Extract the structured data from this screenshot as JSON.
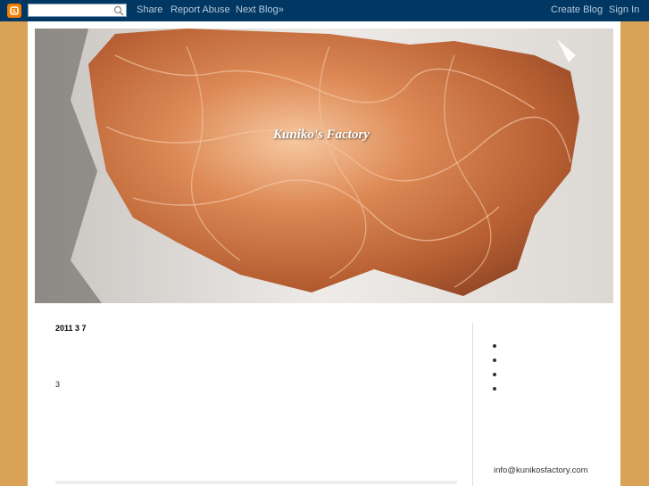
{
  "navbar": {
    "search": {
      "value": "",
      "placeholder": ""
    },
    "links": {
      "share": "Share",
      "report_abuse": "Report Abuse",
      "next_blog": "Next Blog»"
    },
    "right_links": {
      "create_blog": "Create Blog",
      "sign_in": "Sign In"
    }
  },
  "header": {
    "title": "Kuniko's Factory"
  },
  "post": {
    "date": "2011  3  7",
    "body": "3"
  },
  "sidebar": {
    "items": [
      "",
      "",
      "",
      ""
    ],
    "email": "info@kunikosfactory.com"
  }
}
